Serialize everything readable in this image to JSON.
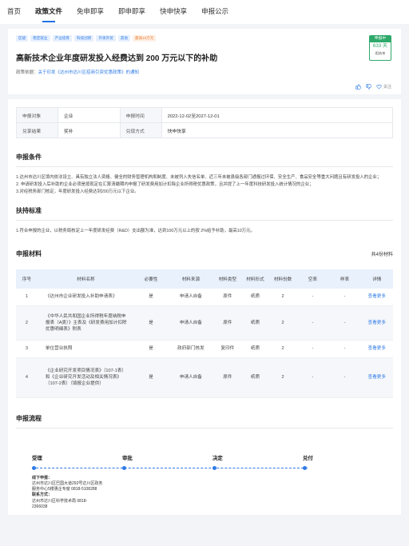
{
  "nav": {
    "tabs": [
      {
        "label": "首页",
        "active": false
      },
      {
        "label": "政策文件",
        "active": true
      },
      {
        "label": "免申即享",
        "active": false
      },
      {
        "label": "即申即享",
        "active": false
      },
      {
        "label": "快申快享",
        "active": false
      },
      {
        "label": "申报公示",
        "active": false
      }
    ]
  },
  "policy": {
    "tags": [
      "区级",
      "稳定就业",
      "产业培育",
      "科技创新",
      "外资外贸",
      "其他"
    ],
    "amount_tag": "最高10万元",
    "title": "高新技术企业年度研发投入经费达到 200 万元以下的补助",
    "basis_label": "政策依据：",
    "basis_link": "关于印发《达州市达川区招商引资优惠政策》的通知",
    "badge": {
      "status": "申报中",
      "days": "633 天",
      "note": "距结束"
    },
    "actions": {
      "like": "",
      "dislike": "",
      "follow": "关注"
    }
  },
  "info": {
    "rows": [
      {
        "k1": "申报对象",
        "v1": "企业",
        "k2": "申报时间",
        "v2": "2022-12-02至2027-12-01"
      },
      {
        "k1": "兑享结果",
        "v1": "奖补",
        "k2": "兑现方式",
        "v2": "快申快享"
      }
    ]
  },
  "conditions": {
    "title": "申报条件",
    "lines": [
      "1.达州市达川区境内依法设立、具有独立法人资格、健全的财务管理机构和制度、未被列入失信名单、近三年未被县级各部门通报过环保、安全生产、食品安全等重大问题且有研发投入的企业；",
      "2. 申请研发投入后补助的企业必须是按现定在汇算清缴期内申报了研发费用加计扣除企业所得税优惠政策，且并提了上一年度科技研发投入统计情况的企业；",
      "3.对经税务部门核定，年度研发投入经费达到200万元以下企业。"
    ]
  },
  "support": {
    "title": "扶持标准",
    "text": "1.符合申报的企业，以税务局核定上一年度研发经费（R&D）支出额为准，达到100万元以上的按 2%给予补助，最高10万元。"
  },
  "materials": {
    "title": "申报材料",
    "count": "共4份材料",
    "headers": [
      "序号",
      "材料名称",
      "必要性",
      "材料来源",
      "材料类型",
      "材料形式",
      "材料份数",
      "空表",
      "样表",
      "详情"
    ],
    "rows": [
      {
        "no": "1",
        "name": "《达州市企业研发投入补助申请表》",
        "need": "是",
        "source": "申请人自备",
        "type": "原件",
        "form": "纸质",
        "qty": "2",
        "blank": "-",
        "sample": "-",
        "detail": "查看更多"
      },
      {
        "no": "2",
        "name": "《中华人民共和国企业所得税年度纳税申报表（A类）》主表及《研发费用加计扣除优惠明细表》附表",
        "need": "是",
        "source": "申请人自备",
        "type": "原件",
        "form": "纸质",
        "qty": "2",
        "blank": "-",
        "sample": "-",
        "detail": "查看更多"
      },
      {
        "no": "3",
        "name": "单位营业执照",
        "need": "是",
        "source": "政府部门核发",
        "type": "复印件",
        "form": "纸质",
        "qty": "2",
        "blank": "-",
        "sample": "-",
        "detail": "查看更多"
      },
      {
        "no": "4",
        "name": "《企业研究开发项目情况表》（107-1表）和《企业研究开发活动及相关情况表》（107-2表）（填报企业提供）",
        "need": "是",
        "source": "申请人自备",
        "type": "原件",
        "form": "纸质",
        "qty": "2",
        "blank": "-",
        "sample": "-",
        "detail": "查看更多"
      }
    ]
  },
  "flow": {
    "title": "申报流程",
    "steps": [
      "受理",
      "审批",
      "决定",
      "兑付"
    ],
    "detail": {
      "offline_label": "线下申报：",
      "offline_lines": [
        "达州市达川区巴国大道292号达川区政务",
        "服务中心5楼惠企专窗 0818-5108288"
      ],
      "contact_label": "联系方式：",
      "contact_lines": [
        "达州市达川区科学技术局 0818-",
        "2366038"
      ]
    },
    "accent": "#2f7be6"
  }
}
